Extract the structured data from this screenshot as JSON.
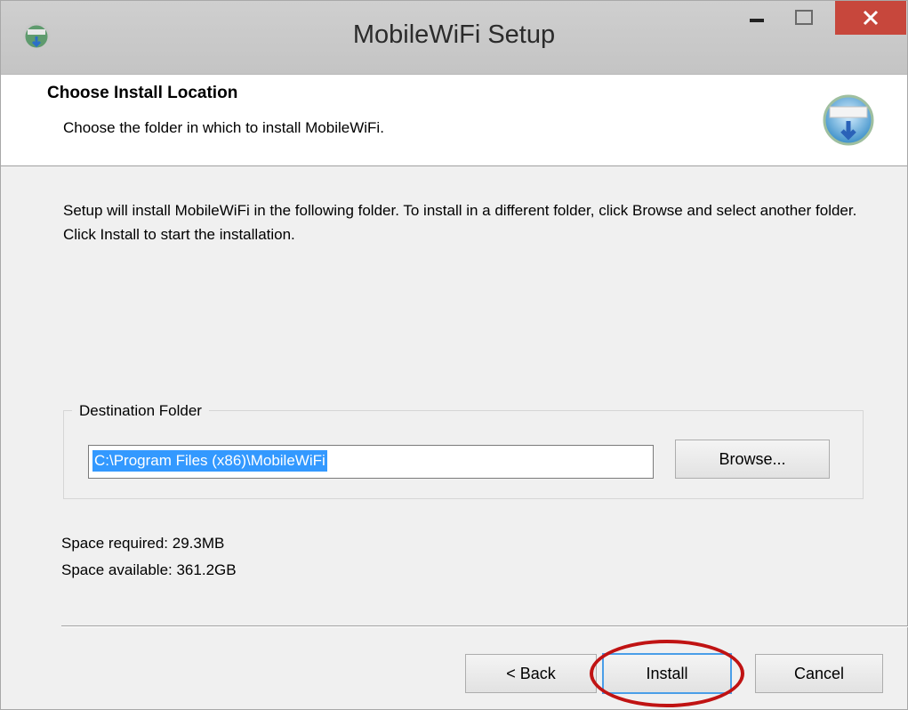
{
  "window": {
    "title": "MobileWiFi Setup",
    "icon": "setup-globe-icon"
  },
  "header": {
    "title": "Choose Install Location",
    "subtitle": "Choose the folder in which to install MobileWiFi."
  },
  "body": {
    "description": "Setup will install MobileWiFi in the following folder. To install in a different folder, click Browse and select another folder. Click Install to start the installation."
  },
  "destination": {
    "group_label": "Destination Folder",
    "path": "C:\\Program Files (x86)\\MobileWiFi",
    "browse_label": "Browse..."
  },
  "space": {
    "required": "Space required: 29.3MB",
    "available": "Space available: 361.2GB"
  },
  "buttons": {
    "back": "< Back",
    "install": "Install",
    "cancel": "Cancel"
  },
  "colors": {
    "close_button": "#c7473c",
    "selection": "#3399ff",
    "highlight_circle": "#c01313"
  }
}
